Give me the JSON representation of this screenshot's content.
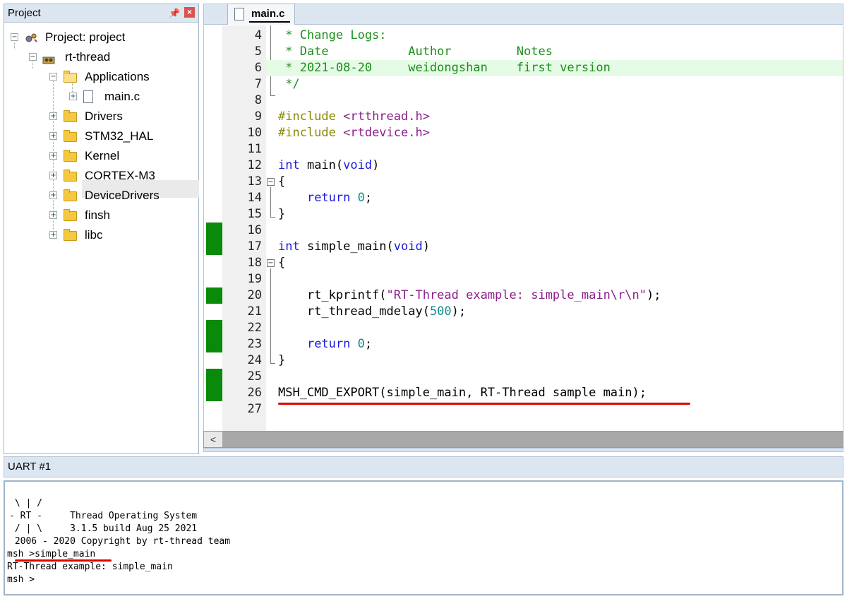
{
  "project_panel": {
    "title": "Project",
    "pin_icon": "pin-icon",
    "close_icon": "close-icon",
    "tree": {
      "root": "Project: project",
      "group": "rt-thread",
      "applications": "Applications",
      "main_file": "main.c",
      "folders": [
        "Drivers",
        "STM32_HAL",
        "Kernel",
        "CORTEX-M3",
        "DeviceDrivers",
        "finsh",
        "libc"
      ]
    }
  },
  "editor": {
    "tab_label": "main.c",
    "lines": [
      {
        "n": "4",
        "text": " * Change Logs:"
      },
      {
        "n": "5",
        "text": " * Date           Author         Notes"
      },
      {
        "n": "6",
        "text": " * 2021-08-20     weidongshan    first version"
      },
      {
        "n": "7",
        "text": " */"
      },
      {
        "n": "8",
        "text": ""
      },
      {
        "n": "9",
        "text": "#include <rtthread.h>"
      },
      {
        "n": "10",
        "text": "#include <rtdevice.h>"
      },
      {
        "n": "11",
        "text": ""
      },
      {
        "n": "12",
        "text": "int main(void)"
      },
      {
        "n": "13",
        "text": "{"
      },
      {
        "n": "14",
        "text": "    return 0;"
      },
      {
        "n": "15",
        "text": "}"
      },
      {
        "n": "16",
        "text": ""
      },
      {
        "n": "17",
        "text": "int simple_main(void)"
      },
      {
        "n": "18",
        "text": "{"
      },
      {
        "n": "19",
        "text": ""
      },
      {
        "n": "20",
        "text": "    rt_kprintf(\"RT-Thread example: simple_main\\r\\n\");"
      },
      {
        "n": "21",
        "text": "    rt_thread_mdelay(500);"
      },
      {
        "n": "22",
        "text": ""
      },
      {
        "n": "23",
        "text": "    return 0;"
      },
      {
        "n": "24",
        "text": "}"
      },
      {
        "n": "25",
        "text": ""
      },
      {
        "n": "26",
        "text": "MSH_CMD_EXPORT(simple_main, RT-Thread sample main);"
      },
      {
        "n": "27",
        "text": ""
      }
    ]
  },
  "uart": {
    "title": "UART #1",
    "lines": [
      " \\ | /",
      "- RT -     Thread Operating System",
      " / | \\     3.1.5 build Aug 25 2021",
      " 2006 - 2020 Copyright by rt-thread team",
      "msh >simple_main",
      "RT-Thread example: simple_main",
      "msh >"
    ]
  },
  "colors": {
    "comment": "#1b8f1b",
    "keyword": "#1a1adc",
    "string": "#8a1e8a",
    "preprocessor": "#8a8a00",
    "number": "#128c8c",
    "change_marker": "#0a8a0a",
    "annotation_underline": "#e00000",
    "panel_header": "#dce6f1"
  }
}
